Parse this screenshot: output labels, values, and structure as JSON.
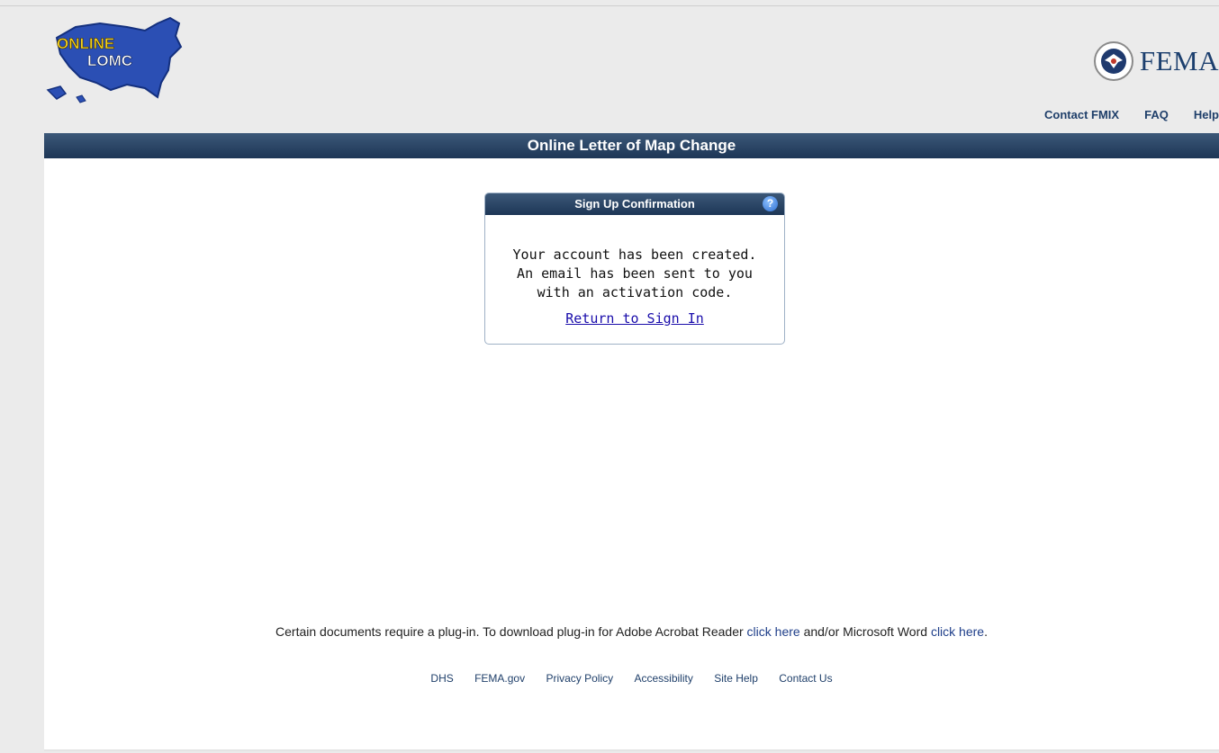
{
  "header": {
    "logo_text_top": "ONLINE",
    "logo_text_bottom": "LOMC",
    "agency": "FEMA",
    "links": [
      "Contact FMIX",
      "FAQ",
      "Help"
    ]
  },
  "title_bar": "Online Letter of Map Change",
  "dialog": {
    "title": "Sign Up Confirmation",
    "help_glyph": "?",
    "lines": [
      "Your account has been created.",
      "An email has been sent to you",
      "with an activation code."
    ],
    "link": "Return to Sign In"
  },
  "plugin_notice": {
    "text_1": "Certain documents require a plug-in. To download plug-in for Adobe Acrobat Reader ",
    "link_1": "click here",
    "text_2": " and/or Microsoft Word ",
    "link_2": "click here",
    "text_3": "."
  },
  "footer_links": [
    "DHS",
    "FEMA.gov",
    "Privacy Policy",
    "Accessibility",
    "Site Help",
    "Contact Us"
  ],
  "colors": {
    "navy": "#1d3656",
    "page_bg": "#ebebeb",
    "link_blue": "#1a0dab"
  },
  "icons": [
    "us-map-logo",
    "dhs-seal-icon",
    "help-icon"
  ]
}
